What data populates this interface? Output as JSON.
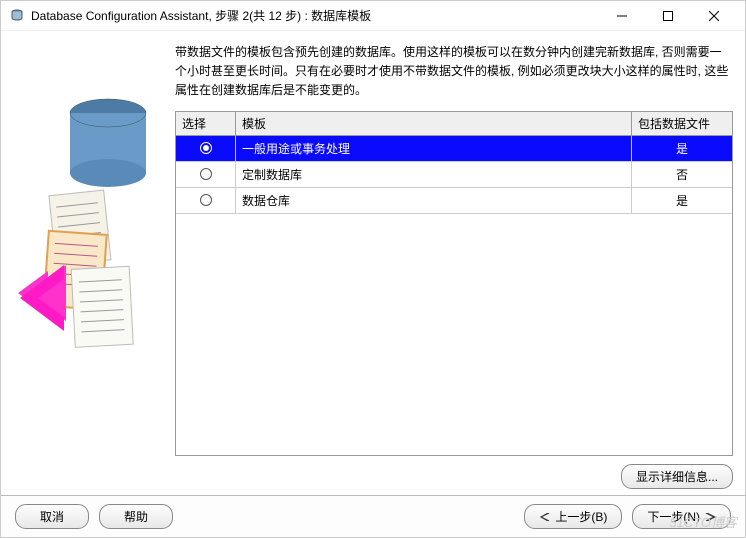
{
  "titlebar": {
    "title": "Database Configuration Assistant, 步骤 2(共 12 步) : 数据库模板"
  },
  "description": "带数据文件的模板包含预先创建的数据库。使用这样的模板可以在数分钟内创建完新数据库, 否则需要一个小时甚至更长时间。只有在必要时才使用不带数据文件的模板, 例如必须更改块大小这样的属性时, 这些属性在创建数据库后是不能变更的。",
  "columns": {
    "select": "选择",
    "template": "模板",
    "includes": "包括数据文件"
  },
  "rows": [
    {
      "name": "一般用途或事务处理",
      "includes": "是",
      "selected": true
    },
    {
      "name": "定制数据库",
      "includes": "否",
      "selected": false
    },
    {
      "name": "数据仓库",
      "includes": "是",
      "selected": false
    }
  ],
  "buttons": {
    "details": "显示详细信息...",
    "cancel": "取消",
    "help": "帮助",
    "back": "上一步(B)",
    "next": "下一步(N)"
  },
  "watermark": "51CTO博客"
}
